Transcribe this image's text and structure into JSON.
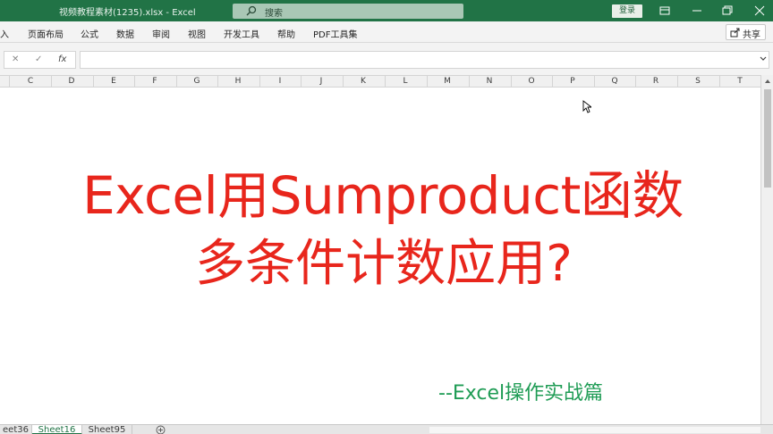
{
  "window": {
    "title": "视频教程素材(1235).xlsx  -  Excel",
    "search_placeholder": "搜索",
    "login_label": "登录"
  },
  "ribbon": {
    "tabs": [
      "入",
      "页面布局",
      "公式",
      "数据",
      "审阅",
      "视图",
      "开发工具",
      "帮助",
      "PDF工具集"
    ],
    "share_label": "共享"
  },
  "formula_bar": {
    "cancel": "✕",
    "enter": "✓",
    "fx": "fx",
    "value": ""
  },
  "columns": [
    "C",
    "D",
    "E",
    "F",
    "G",
    "H",
    "I",
    "J",
    "K",
    "L",
    "M",
    "N",
    "O",
    "P",
    "Q",
    "R",
    "S",
    "T"
  ],
  "content": {
    "title_line1": "Excel用Sumproduct函数",
    "title_line2": "多条件计数应用?",
    "subtitle": "--Excel操作实战篇",
    "title_color": "#e8261c",
    "subtitle_color": "#1f9c55"
  },
  "sheets": {
    "tabs": [
      "eet36",
      "Sheet16",
      "Sheet95"
    ],
    "active": "Sheet16"
  },
  "colors": {
    "brand": "#217346"
  }
}
